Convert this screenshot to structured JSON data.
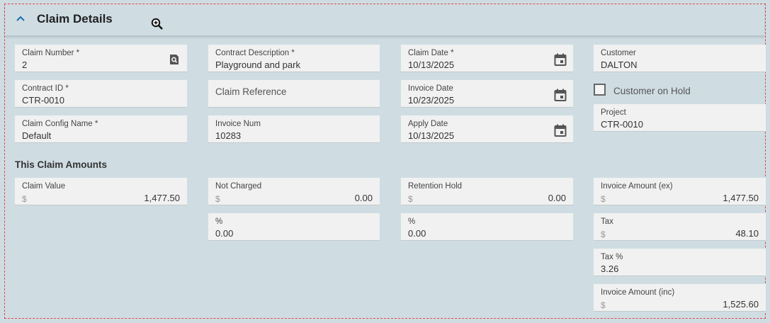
{
  "panel": {
    "title": "Claim Details"
  },
  "fields": {
    "claim_number": {
      "label": "Claim Number *",
      "value": "2"
    },
    "contract_id": {
      "label": "Contract ID *",
      "value": "CTR-0010"
    },
    "claim_config_name": {
      "label": "Claim Config Name *",
      "value": "Default"
    },
    "contract_description": {
      "label": "Contract Description *",
      "value": "Playground and park"
    },
    "claim_reference": {
      "placeholder": "Claim Reference"
    },
    "invoice_num": {
      "label": "Invoice Num",
      "value": "10283"
    },
    "claim_date": {
      "label": "Claim Date *",
      "value": "10/13/2025"
    },
    "invoice_date": {
      "label": "Invoice Date",
      "value": "10/23/2025"
    },
    "apply_date": {
      "label": "Apply Date",
      "value": "10/13/2025"
    },
    "customer": {
      "label": "Customer",
      "value": "DALTON"
    },
    "customer_on_hold": {
      "label": "Customer on Hold",
      "checked": false
    },
    "project": {
      "label": "Project",
      "value": "CTR-0010"
    }
  },
  "amounts": {
    "section_title": "This Claim Amounts",
    "currency_symbol": "$",
    "claim_value": {
      "label": "Claim Value",
      "value": "1,477.50"
    },
    "not_charged": {
      "label": "Not Charged",
      "value": "0.00"
    },
    "not_charged_pct": {
      "label": "%",
      "value": "0.00"
    },
    "retention_hold": {
      "label": "Retention Hold",
      "value": "0.00"
    },
    "retention_hold_pct": {
      "label": "%",
      "value": "0.00"
    },
    "invoice_amount_ex": {
      "label": "Invoice Amount (ex)",
      "value": "1,477.50"
    },
    "tax": {
      "label": "Tax",
      "value": "48.10"
    },
    "tax_pct": {
      "label": "Tax %",
      "value": "3.26"
    },
    "invoice_amount_inc": {
      "label": "Invoice Amount (inc)",
      "value": "1,525.60"
    }
  },
  "colors": {
    "background": "#cfdde3",
    "field_background": "#f1f1f1",
    "accent": "#1a6fa8",
    "dashed_border": "#e04848"
  }
}
